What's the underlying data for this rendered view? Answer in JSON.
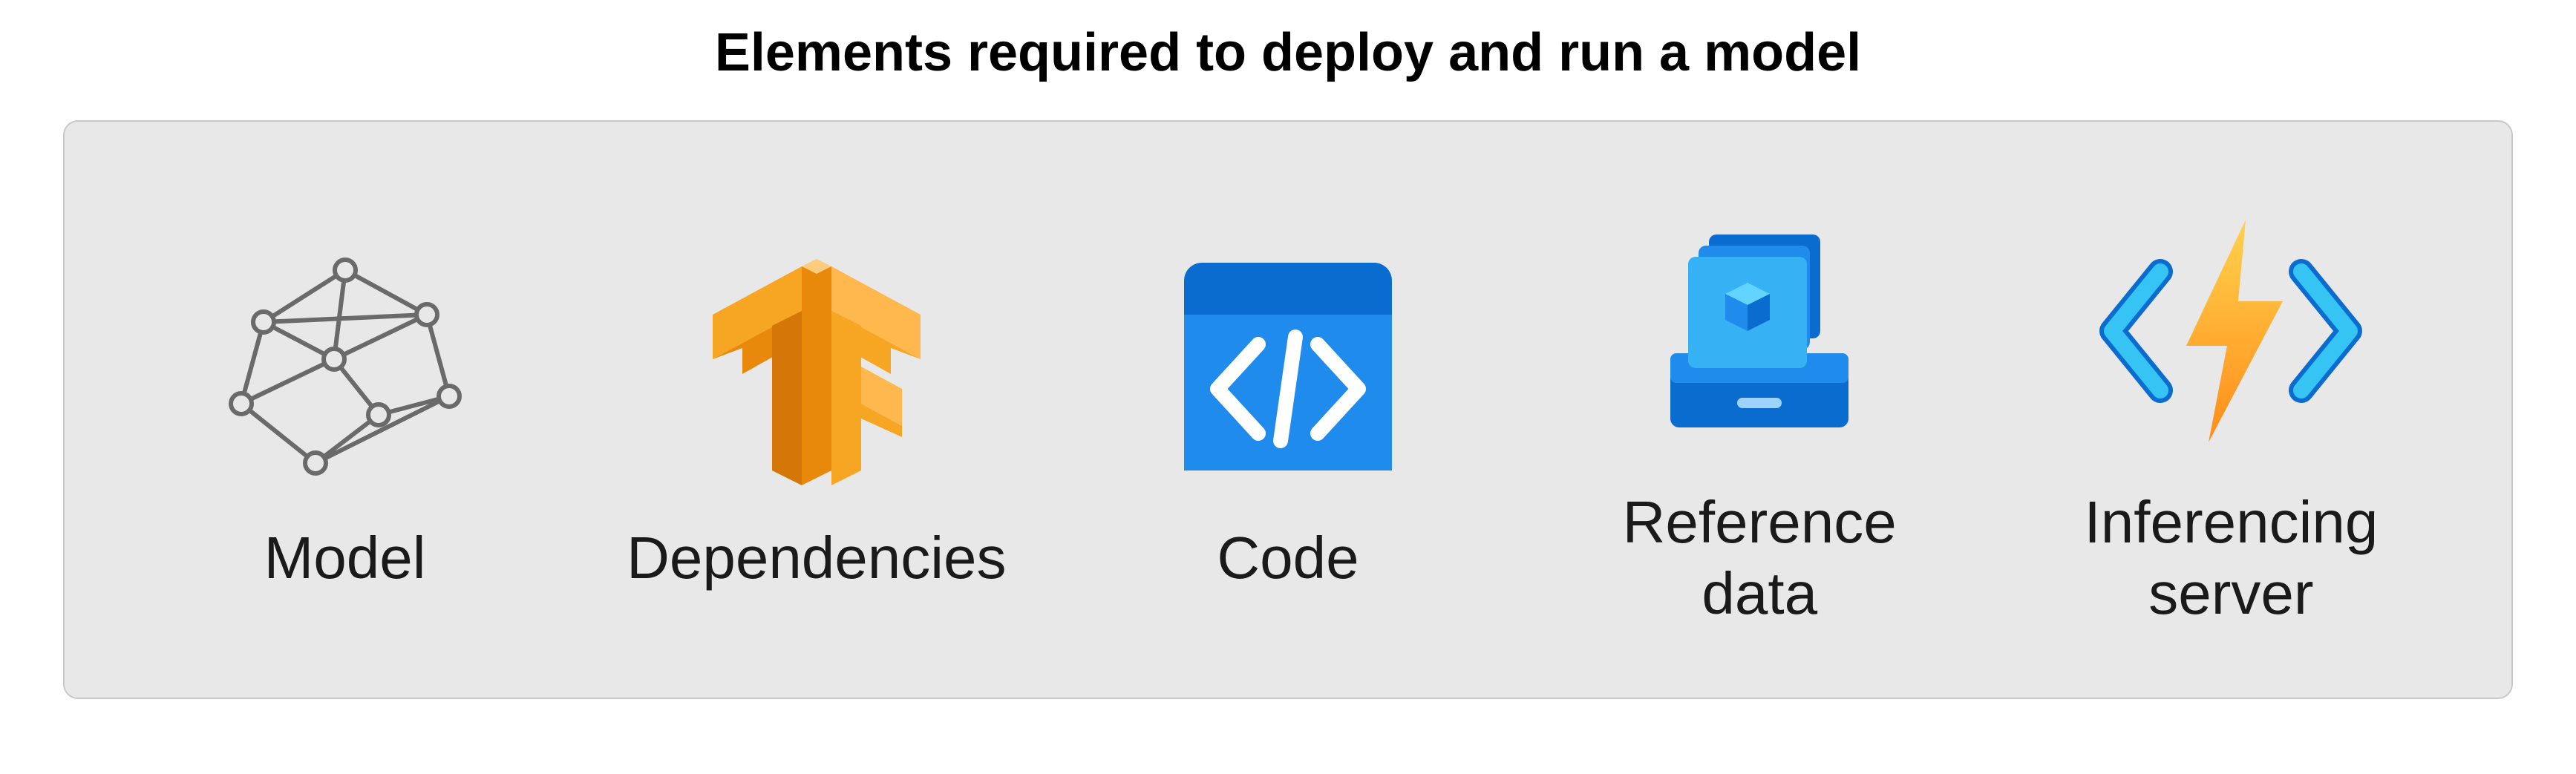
{
  "title": "Elements required to deploy and run a model",
  "items": [
    {
      "label": "Model",
      "icon": "model-graph-icon"
    },
    {
      "label": "Dependencies",
      "icon": "tensorflow-icon"
    },
    {
      "label": "Code",
      "icon": "code-icon"
    },
    {
      "label": "Reference\ndata",
      "icon": "reference-data-icon"
    },
    {
      "label": "Inferencing\nserver",
      "icon": "inferencing-server-icon"
    }
  ]
}
